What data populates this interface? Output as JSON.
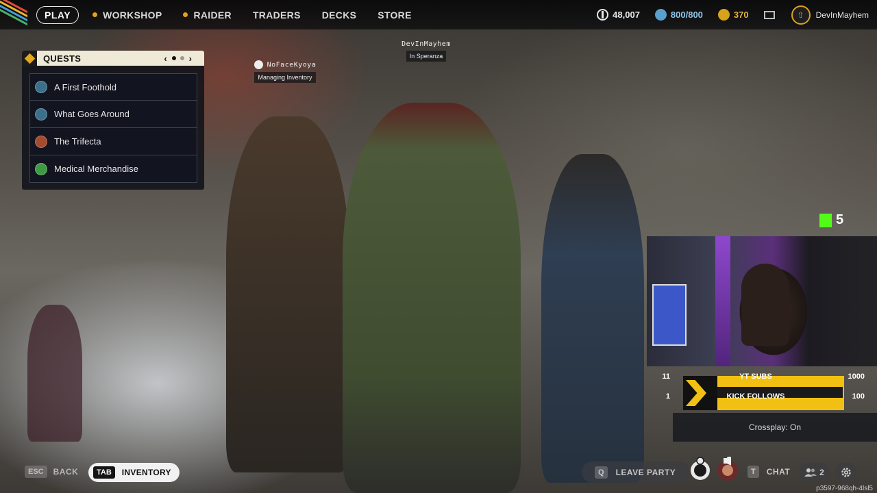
{
  "nav": {
    "play_label": "PLAY",
    "items": [
      {
        "label": "WORKSHOP",
        "icon": "dot-icon"
      },
      {
        "label": "RAIDER",
        "icon": "dot-icon"
      },
      {
        "label": "TRADERS"
      },
      {
        "label": "DECKS"
      },
      {
        "label": "STORE"
      }
    ],
    "currencies": [
      {
        "icon": "coin-icon",
        "value": "48,007"
      },
      {
        "icon": "credits-icon",
        "value": "800/800"
      },
      {
        "icon": "gold-icon",
        "value": "370"
      }
    ],
    "username": "DevInMayhem"
  },
  "quests": {
    "title": "QUESTS",
    "items": [
      {
        "label": "A First Foothold",
        "color": "#3b6f8a"
      },
      {
        "label": "What Goes Around",
        "color": "#3b6f8a"
      },
      {
        "label": "The Trifecta",
        "color": "#a44a2e"
      },
      {
        "label": "Medical Merchandise",
        "color": "#3f9a45"
      }
    ]
  },
  "players": [
    {
      "name": "NoFaceKyoya",
      "status": "Managing Inventory"
    },
    {
      "name": "DevInMayhem",
      "status": "In Speranza"
    }
  ],
  "overlay": {
    "kick_count": "5",
    "goal_rows": [
      {
        "left": "11",
        "label": "YT SUBS",
        "right": "1000"
      },
      {
        "left": "1",
        "label": "KICK FOLLOWS",
        "right": "100"
      }
    ],
    "crossplay": "Crossplay: On"
  },
  "bottom": {
    "back_key": "ESC",
    "back_label": "BACK",
    "inventory_key": "TAB",
    "inventory_label": "INVENTORY",
    "leave_key": "Q",
    "leave_label": "LEAVE PARTY",
    "chat_key": "T",
    "chat_label": "CHAT",
    "friends_count": "2",
    "session_id": "p3597-968qh-4lsl5"
  },
  "colors": {
    "accent": "#e3a61f",
    "kick_green": "#53fc18",
    "goal_yellow": "#f2c012"
  }
}
